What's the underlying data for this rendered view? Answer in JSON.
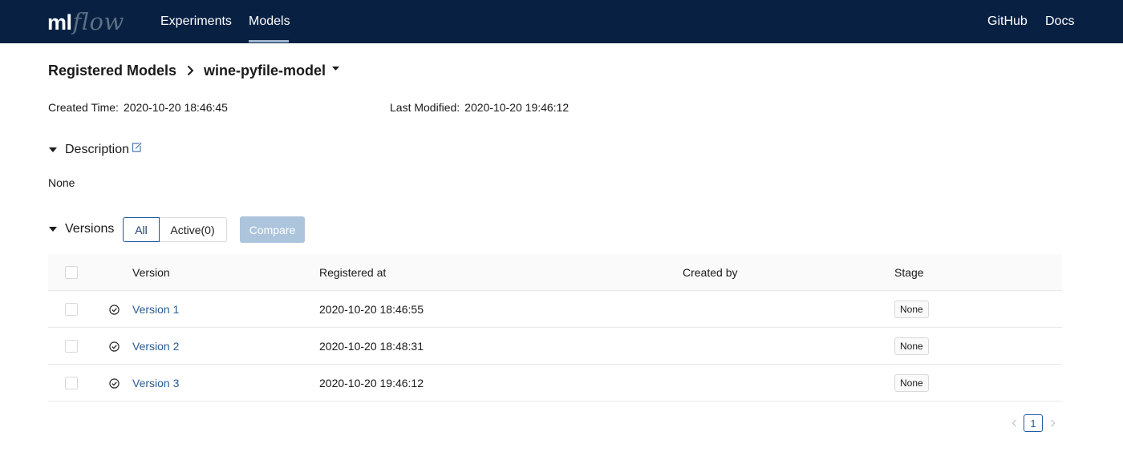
{
  "header": {
    "logo_ml": "ml",
    "logo_flow": "flow",
    "nav": {
      "experiments": "Experiments",
      "models": "Models",
      "github": "GitHub",
      "docs": "Docs"
    },
    "active_nav": "models",
    "colors": {
      "background": "#082143",
      "logo_accent": "#5e6f86"
    }
  },
  "breadcrumb": {
    "root": "Registered Models",
    "separator_icon": "chevron-right-icon",
    "model_name": "wine-pyfile-model",
    "dropdown_icon": "caret-down-icon"
  },
  "metadata": {
    "created_label": "Created Time:",
    "created_value": "2020-10-20 18:46:45",
    "modified_label": "Last Modified:",
    "modified_value": "2020-10-20 19:46:12"
  },
  "description": {
    "title": "Description",
    "edit_icon": "edit-icon",
    "value": "None"
  },
  "versions": {
    "title": "Versions",
    "filter_all": "All",
    "filter_active": "Active(0)",
    "selected_filter": "All",
    "compare_label": "Compare",
    "compare_enabled": false,
    "columns": {
      "version": "Version",
      "registered_at": "Registered at",
      "created_by": "Created by",
      "stage": "Stage"
    },
    "rows": [
      {
        "status_icon": "check-circle-icon",
        "version": "Version 1",
        "registered_at": "2020-10-20 18:46:55",
        "created_by": "",
        "stage": "None"
      },
      {
        "status_icon": "check-circle-icon",
        "version": "Version 2",
        "registered_at": "2020-10-20 18:48:31",
        "created_by": "",
        "stage": "None"
      },
      {
        "status_icon": "check-circle-icon",
        "version": "Version 3",
        "registered_at": "2020-10-20 19:46:12",
        "created_by": "",
        "stage": "None"
      }
    ]
  },
  "pagination": {
    "current_page": "1",
    "prev_icon": "chevron-left-icon",
    "next_icon": "chevron-right-icon"
  }
}
